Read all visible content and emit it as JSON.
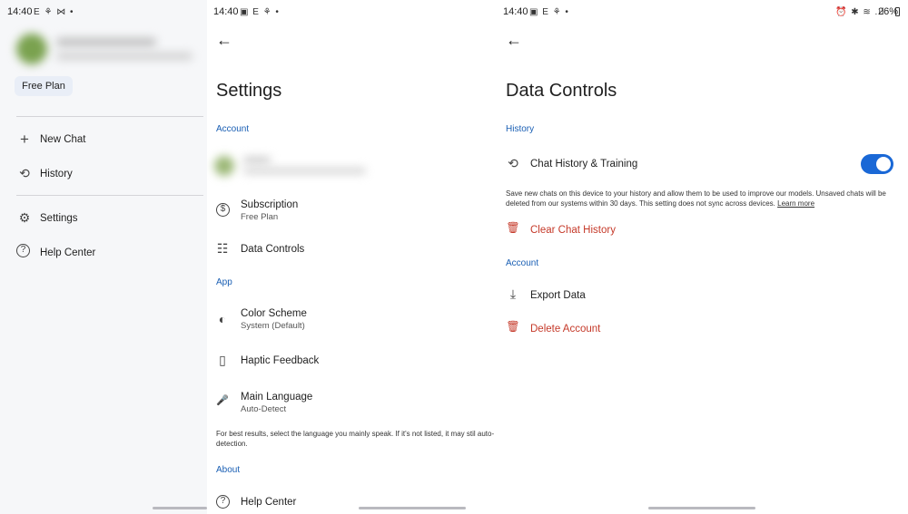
{
  "drawer": {
    "time": "14:40",
    "status_icons": "E ⚘ ⋈ •",
    "plan": "Free Plan",
    "items": [
      {
        "icon": "plus-icon",
        "glyph": "+",
        "label": "New Chat"
      },
      {
        "icon": "history-icon",
        "glyph": "⟲",
        "label": "History"
      },
      {
        "icon": "gear-icon",
        "glyph": "⚙",
        "label": "Settings"
      },
      {
        "icon": "help-icon",
        "glyph": "?",
        "label": "Help Center"
      }
    ]
  },
  "settings": {
    "time": "14:40",
    "status_icons": "▣ E ⚘ •",
    "back_glyph": "←",
    "title": "Settings",
    "section_account": "Account",
    "subscription": {
      "title": "Subscription",
      "subtitle": "Free Plan",
      "icon": "dollar-icon",
      "glyph": "$"
    },
    "data_controls": {
      "title": "Data Controls",
      "icon": "sliders-icon",
      "glyph": "☷"
    },
    "section_app": "App",
    "color_scheme": {
      "title": "Color Scheme",
      "subtitle": "System (Default)",
      "icon": "brightness-icon",
      "glyph": "◐"
    },
    "haptic": {
      "title": "Haptic Feedback",
      "icon": "vibration-icon",
      "glyph": "▯"
    },
    "language": {
      "title": "Main Language",
      "subtitle": "Auto-Detect",
      "icon": "microphone-icon",
      "glyph": "🎤"
    },
    "language_note": "For best results, select the language you mainly speak. If it's not listed, it may stil auto-detection.",
    "section_about": "About",
    "help_center": {
      "title": "Help Center",
      "icon": "help-icon",
      "glyph": "?"
    }
  },
  "data_controls": {
    "time": "14:40",
    "status_icons": "▣ E ⚘ •",
    "right_status_icons": "⏰ ✱ ≋ .ıl",
    "battery": "26%",
    "back_glyph": "←",
    "title": "Data Controls",
    "section_history": "History",
    "chat_history": {
      "title": "Chat History & Training",
      "icon": "history-icon",
      "glyph": "⟲",
      "enabled": true
    },
    "chat_history_note": "Save new chats on this device to your history and allow them to be used to improve our models. Unsaved chats will be deleted from our systems within 30 days. This setting does not sync across devices.",
    "learn_more": "Learn more",
    "clear_history": {
      "title": "Clear Chat History",
      "icon": "trash-icon",
      "glyph": "🗑"
    },
    "section_account": "Account",
    "export": {
      "title": "Export Data",
      "icon": "download-icon",
      "glyph": "⤓"
    },
    "delete": {
      "title": "Delete Account",
      "icon": "trash-icon",
      "glyph": "🗑"
    }
  },
  "colors": {
    "accent": "#1a5fb4",
    "toggle": "#1a68d6",
    "danger": "#c53929",
    "drawer_bg": "#f6f7f9"
  }
}
